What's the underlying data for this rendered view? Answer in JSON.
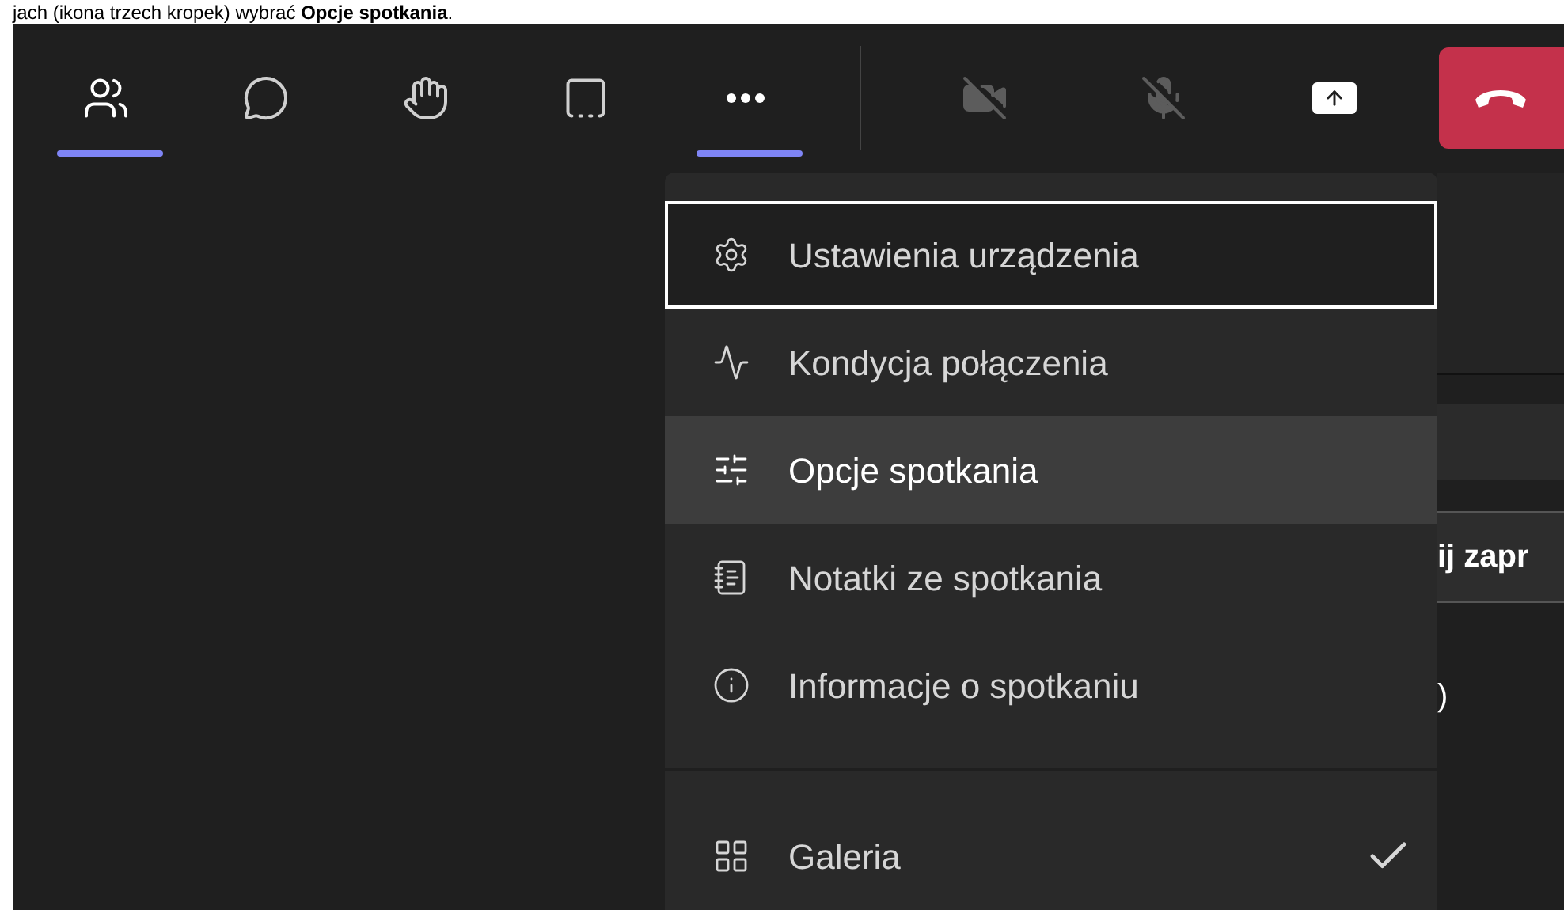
{
  "caption": "jach (ikona trzech kropek) wybrać **Opcje spotkania**.",
  "toolbar": [
    {
      "kind": "people",
      "selected": true
    },
    {
      "kind": "chat",
      "selected": false
    },
    {
      "kind": "react",
      "selected": false
    },
    {
      "kind": "rooms",
      "selected": false
    },
    {
      "kind": "more",
      "selected": true
    }
  ],
  "call_controls": [
    {
      "kind": "camera",
      "disabled": true
    },
    {
      "kind": "mic",
      "disabled": true
    },
    {
      "kind": "share",
      "disabled": false
    },
    {
      "kind": "hangup",
      "disabled": false
    }
  ],
  "menu": {
    "groups": [
      [
        {
          "kind": "settings",
          "label": "Ustawienia urządzenia",
          "focused": true,
          "highlighted": false,
          "checked": false
        },
        {
          "kind": "health",
          "label": "Kondycja połączenia",
          "focused": false,
          "highlighted": false,
          "checked": false
        },
        {
          "kind": "options",
          "label": "Opcje spotkania",
          "focused": false,
          "highlighted": true,
          "checked": false
        },
        {
          "kind": "notes",
          "label": "Notatki ze spotkania",
          "focused": false,
          "highlighted": false,
          "checked": false
        },
        {
          "kind": "info",
          "label": "Informacje o spotkaniu",
          "focused": false,
          "highlighted": false,
          "checked": false
        }
      ],
      [
        {
          "kind": "gallery",
          "label": "Galeria",
          "focused": false,
          "highlighted": false,
          "checked": true
        }
      ]
    ]
  },
  "side_panel": {
    "button_text": "ij zapr",
    "text_2": ")"
  }
}
